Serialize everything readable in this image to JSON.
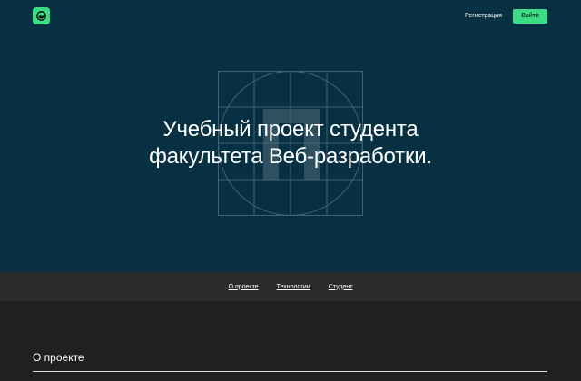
{
  "header": {
    "logo_icon": "smiley-face-icon",
    "register_label": "Регистрация",
    "login_label": "Войти"
  },
  "hero": {
    "title": "Учебный проект студента факультета Веб-разработки.",
    "graphic_icon": "grid-circle-letter-p-graphic"
  },
  "nav": {
    "items": [
      {
        "label": "О проекте"
      },
      {
        "label": "Технологии"
      },
      {
        "label": "Студент"
      }
    ]
  },
  "about": {
    "heading": "О проекте"
  },
  "colors": {
    "hero_bg": "#073042",
    "accent": "#3ddc84",
    "nav_bg": "#2c2c2c",
    "page_bg": "#202020"
  }
}
